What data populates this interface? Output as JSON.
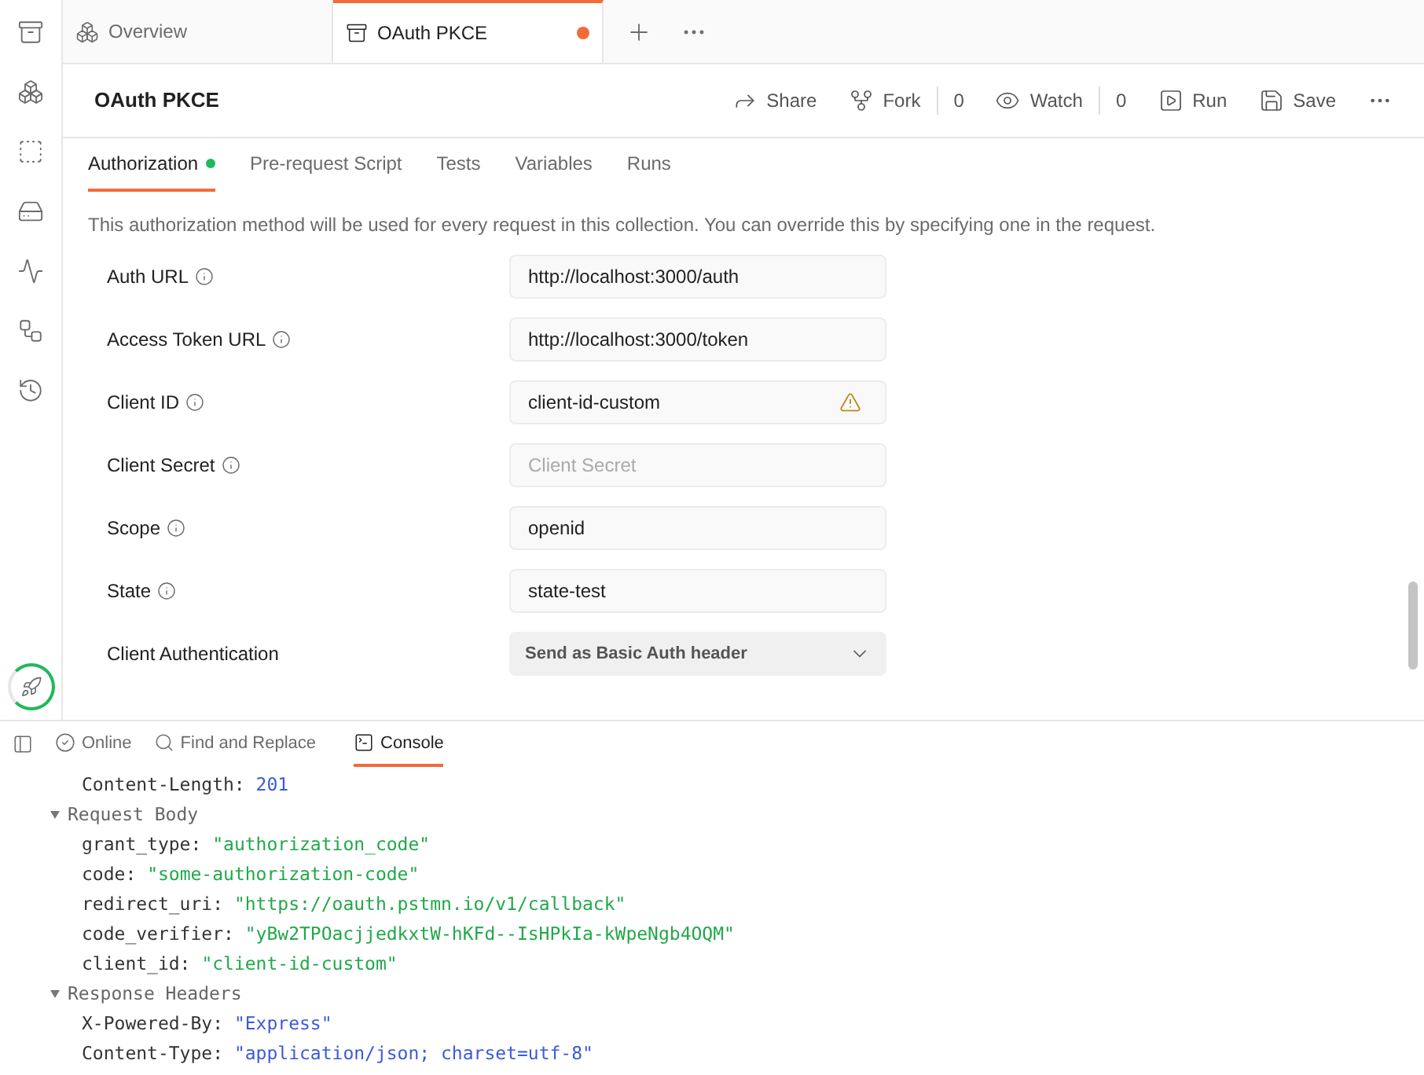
{
  "tabs": [
    {
      "label": "Overview",
      "kind": "overview",
      "selected": false,
      "unsaved": false
    },
    {
      "label": "OAuth PKCE",
      "kind": "collection",
      "selected": true,
      "unsaved": true
    }
  ],
  "header": {
    "title": "OAuth PKCE",
    "actions": [
      {
        "label": "Share",
        "kind": "share"
      },
      {
        "label": "Fork",
        "kind": "fork",
        "count": "0"
      },
      {
        "label": "Watch",
        "kind": "watch",
        "count": "0"
      },
      {
        "label": "Run",
        "kind": "run"
      },
      {
        "label": "Save",
        "kind": "save"
      }
    ]
  },
  "subtabs": [
    {
      "label": "Authorization",
      "selected": true,
      "dot": true
    },
    {
      "label": "Pre-request Script",
      "selected": false,
      "dot": false
    },
    {
      "label": "Tests",
      "selected": false,
      "dot": false
    },
    {
      "label": "Variables",
      "selected": false,
      "dot": false
    },
    {
      "label": "Runs",
      "selected": false,
      "dot": false
    }
  ],
  "description": "This authorization method will be used for every request in this collection. You can override this by specifying one in the request.",
  "fields": [
    {
      "label": "Auth URL",
      "kind": "input",
      "info": true,
      "value": "http://localhost:3000/auth",
      "warning": false
    },
    {
      "label": "Access Token URL",
      "kind": "input",
      "info": true,
      "value": "http://localhost:3000/token",
      "warning": false
    },
    {
      "label": "Client ID",
      "kind": "input",
      "info": true,
      "value": "client-id-custom",
      "warning": true
    },
    {
      "label": "Client Secret",
      "kind": "input",
      "info": true,
      "placeholder": "Client Secret",
      "warning": false
    },
    {
      "label": "Scope",
      "kind": "input",
      "info": true,
      "value": "openid",
      "warning": false
    },
    {
      "label": "State",
      "kind": "input",
      "info": true,
      "value": "state-test",
      "warning": false
    },
    {
      "label": "Client Authentication",
      "kind": "select",
      "info": false,
      "value": "Send as Basic Auth header",
      "warning": false
    }
  ],
  "footer": {
    "items": [
      {
        "label": "Online",
        "kind": "online",
        "selected": false
      },
      {
        "label": "Find and Replace",
        "kind": "find",
        "selected": false
      },
      {
        "label": "Console",
        "kind": "console",
        "selected": true
      }
    ]
  },
  "console": [
    {
      "kind": "entry",
      "key": "Content-Length:",
      "value": "201",
      "color": "#3b5bd9"
    },
    {
      "kind": "section",
      "label": "Request Body",
      "expanded": true
    },
    {
      "kind": "entry",
      "key": "grant_type:",
      "value": "\"authorization_code\"",
      "color": "#22a84a"
    },
    {
      "kind": "entry",
      "key": "code:",
      "value": "\"some-authorization-code\"",
      "color": "#22a84a"
    },
    {
      "kind": "entry",
      "key": "redirect_uri:",
      "value": "\"https://oauth.pstmn.io/v1/callback\"",
      "color": "#22a84a"
    },
    {
      "kind": "entry",
      "key": "code_verifier:",
      "value": "\"yBw2TPOacjjedkxtW-hKFd--IsHPkIa-kWpeNgb4OQM\"",
      "color": "#22a84a"
    },
    {
      "kind": "entry",
      "key": "client_id:",
      "value": "\"client-id-custom\"",
      "color": "#22a84a"
    },
    {
      "kind": "section",
      "label": "Response Headers",
      "expanded": true
    },
    {
      "kind": "entry",
      "key": "X-Powered-By:",
      "value": "\"Express\"",
      "color": "#3b5bd9"
    },
    {
      "kind": "entry",
      "key": "Content-Type:",
      "value": "\"application/json; charset=utf-8\"",
      "color": "#3b5bd9"
    }
  ]
}
